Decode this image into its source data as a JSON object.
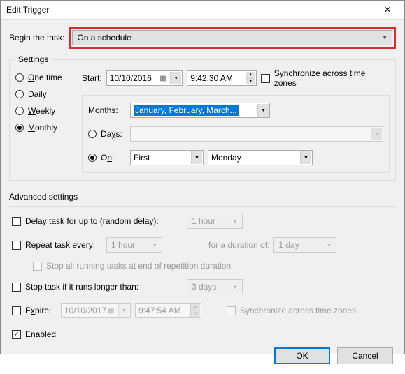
{
  "window": {
    "title": "Edit Trigger",
    "close": "✕"
  },
  "begin": {
    "label": "Begin the task:",
    "value": "On a schedule"
  },
  "settings": {
    "legend": "Settings",
    "radios": {
      "one_time": "One time",
      "daily": "Daily",
      "weekly": "Weekly",
      "monthly": "Monthly",
      "selected": "monthly"
    },
    "start_label": "Start:",
    "start_date": "10/10/2016",
    "start_time": "9:42:30 AM",
    "sync_tz_label": "Synchronize across time zones",
    "months_label": "Months:",
    "months_value": "January, February, March...",
    "days_label": "Days:",
    "on_label": "On:",
    "on_ordinal": "First",
    "on_weekday": "Monday"
  },
  "advanced": {
    "legend": "Advanced settings",
    "delay_label": "Delay task for up to (random delay):",
    "delay_value": "1 hour",
    "repeat_label": "Repeat task every:",
    "repeat_value": "1 hour",
    "duration_label": "for a duration of:",
    "duration_value": "1 day",
    "stop_running_label": "Stop all running tasks at end of repetition duration",
    "stop_if_label": "Stop task if it runs longer than:",
    "stop_if_value": "3 days",
    "expire_label": "Expire:",
    "expire_date": "10/10/2017",
    "expire_time": "9:47:54 AM",
    "expire_sync_label": "Synchronize across time zones",
    "enabled_label": "Enabled"
  },
  "buttons": {
    "ok": "OK",
    "cancel": "Cancel"
  }
}
